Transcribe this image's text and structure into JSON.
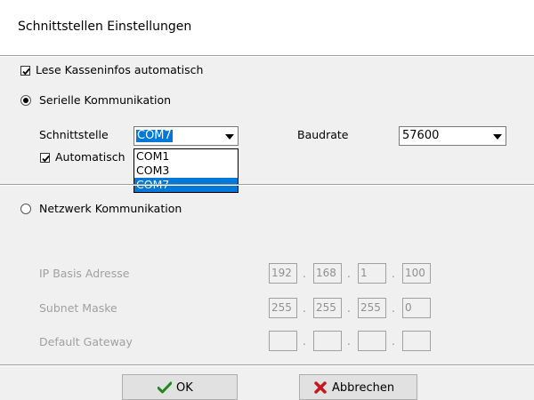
{
  "window": {
    "title": "Schnittstellen Einstellungen"
  },
  "options": {
    "read_cash_info_label": "Lese Kasseninfos automatisch",
    "read_cash_info_checked": true,
    "serial_label": "Serielle Kommunikation",
    "serial_selected": true,
    "auto_label": "Automatisch",
    "auto_checked": true,
    "network_label": "Netzwerk Kommunikation",
    "network_selected": false
  },
  "serial": {
    "port_label": "Schnittstelle",
    "port_value": "COM7",
    "port_options": [
      "COM1",
      "COM3",
      "COM7"
    ],
    "port_highlighted": "COM7",
    "baud_label": "Baudrate",
    "baud_value": "57600"
  },
  "network": {
    "ip_label": "IP Basis Adresse",
    "ip_octets": [
      "192",
      "168",
      "1",
      "100"
    ],
    "subnet_label": "Subnet Maske",
    "subnet_octets": [
      "255",
      "255",
      "255",
      "0"
    ],
    "gateway_label": "Default Gateway",
    "gateway_octets": [
      "",
      "",
      "",
      ""
    ],
    "separator": "."
  },
  "buttons": {
    "ok_label": "OK",
    "cancel_label": "Abbrechen"
  },
  "icons": {
    "ok": "checkmark-icon",
    "cancel": "cross-icon"
  },
  "colors": {
    "selection": "#0078d7",
    "ok_icon": "#1c8a1c",
    "cancel_icon": "#c8161d"
  }
}
